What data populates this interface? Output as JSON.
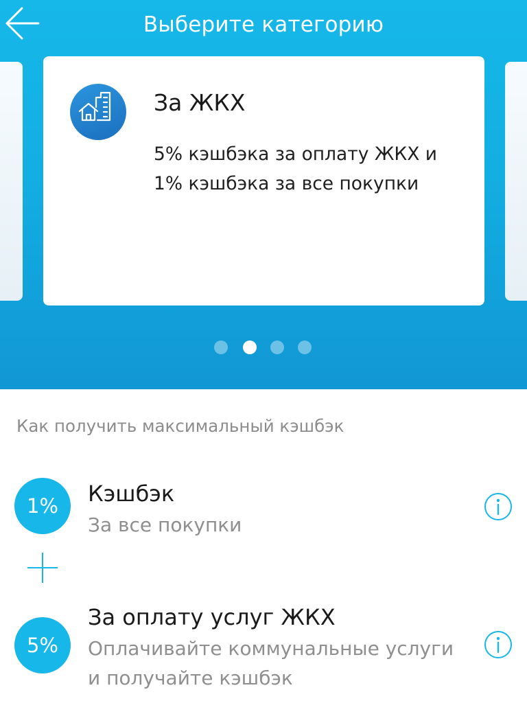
{
  "header": {
    "title": "Выберите категорию",
    "back_icon": "arrow-left-icon"
  },
  "carousel": {
    "active_index": 1,
    "total": 4,
    "card": {
      "icon": "house-building-icon",
      "title": "За ЖКХ",
      "description_line1": "5% кэшбэка за оплату ЖКХ и",
      "description_line2": "1% кэшбэка за все покупки"
    }
  },
  "section": {
    "label": "Как получить максимальный кэшбэк"
  },
  "cashback_items": [
    {
      "badge": "1%",
      "title": "Кэшбэк",
      "subtitle_line1": "За все покупки",
      "subtitle_line2": "",
      "info_icon": "info-icon"
    },
    {
      "badge": "5%",
      "title": "За оплату услуг ЖКХ",
      "subtitle_line1": "Оплачивайте коммунальные услуги",
      "subtitle_line2": "и получайте кэшбэк",
      "info_icon": "info-icon"
    }
  ],
  "colors": {
    "accent": "#18b7ea",
    "header_bg": "#13aee2",
    "icon_bg": "#1b6fbf",
    "muted_text": "#8c8c8c"
  }
}
